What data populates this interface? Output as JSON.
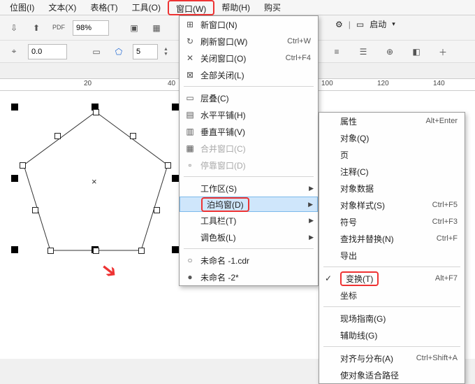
{
  "menubar": {
    "items": [
      "位图(I)",
      "文本(X)",
      "表格(T)",
      "工具(O)",
      "窗口(W)",
      "帮助(H)",
      "购买"
    ],
    "highlighted_index": 4
  },
  "toolbar1": {
    "zoom": "98%",
    "launch_label": "启动"
  },
  "toolbar2": {
    "coord": "0.0",
    "sides": "5"
  },
  "ruler": {
    "ticks": [
      " ",
      "20",
      "40",
      "100",
      "120",
      "140"
    ]
  },
  "menu1": {
    "items": [
      {
        "icon": "⊞",
        "label": "新窗口(N)"
      },
      {
        "icon": "↻",
        "label": "刷新窗口(W)",
        "shortcut": "Ctrl+W"
      },
      {
        "icon": "✕",
        "label": "关闭窗口(O)",
        "shortcut": "Ctrl+F4"
      },
      {
        "icon": "⊠",
        "label": "全部关闭(L)"
      },
      {
        "sep": true
      },
      {
        "icon": "▭",
        "label": "层叠(C)"
      },
      {
        "icon": "▤",
        "label": "水平平铺(H)"
      },
      {
        "icon": "▥",
        "label": "垂直平铺(V)"
      },
      {
        "icon": "▦",
        "label": "合并窗口(C)",
        "disabled": true
      },
      {
        "icon": "▫",
        "label": "停靠窗口(D)",
        "disabled": true
      },
      {
        "sep": true
      },
      {
        "label": "工作区(S)",
        "submenu": true
      },
      {
        "label": "泊坞窗(D)",
        "submenu": true,
        "highlight": true,
        "redbox": true
      },
      {
        "label": "工具栏(T)",
        "submenu": true
      },
      {
        "label": "调色板(L)",
        "submenu": true
      },
      {
        "sep": true
      },
      {
        "bullet": "○",
        "label": "未命名 -1.cdr"
      },
      {
        "bullet": "●",
        "label": "未命名 -2*"
      }
    ]
  },
  "menu2": {
    "items": [
      {
        "label": "属性",
        "shortcut": "Alt+Enter"
      },
      {
        "label": "对象(Q)"
      },
      {
        "label": "页"
      },
      {
        "label": "注释(C)"
      },
      {
        "label": "对象数据"
      },
      {
        "label": "对象样式(S)",
        "shortcut": "Ctrl+F5"
      },
      {
        "label": "符号",
        "shortcut": "Ctrl+F3"
      },
      {
        "label": "查找并替换(N)",
        "shortcut": "Ctrl+F"
      },
      {
        "label": "导出"
      },
      {
        "sep": true
      },
      {
        "label": "变换(T)",
        "shortcut": "Alt+F7",
        "check": true,
        "redbox": true
      },
      {
        "label": "坐标"
      },
      {
        "sep": true
      },
      {
        "label": "现场指南(G)"
      },
      {
        "label": "辅助线(G)"
      },
      {
        "sep": true
      },
      {
        "label": "对齐与分布(A)",
        "shortcut": "Ctrl+Shift+A"
      },
      {
        "label": "使对象适合路径"
      }
    ]
  }
}
